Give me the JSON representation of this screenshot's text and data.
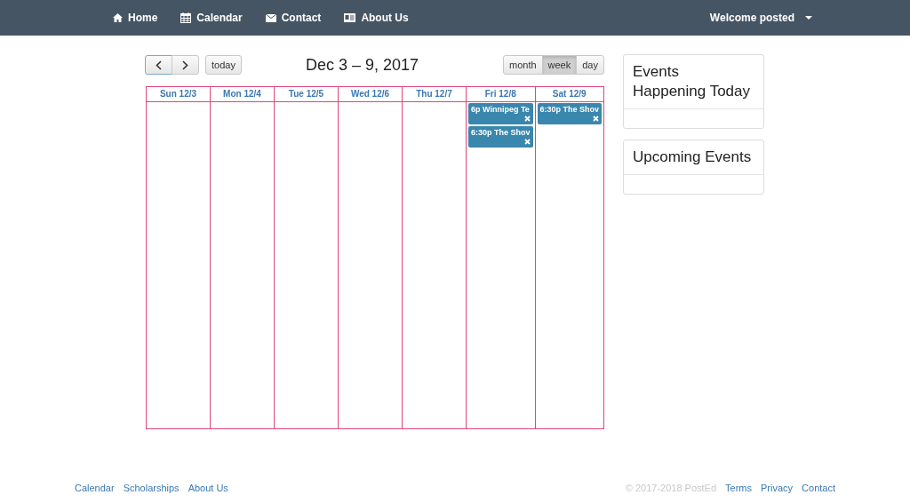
{
  "navbar": {
    "links": [
      {
        "label": "Home"
      },
      {
        "label": "Calendar"
      },
      {
        "label": "Contact"
      },
      {
        "label": "About Us"
      }
    ],
    "user_menu": "Welcome posted"
  },
  "toolbar": {
    "today": "today",
    "title": "Dec 3 – 9, 2017",
    "views": [
      {
        "label": "month",
        "selected": false
      },
      {
        "label": "week",
        "selected": true
      },
      {
        "label": "day",
        "selected": false
      }
    ]
  },
  "calendar": {
    "days": [
      {
        "label": "Sun 12/3"
      },
      {
        "label": "Mon 12/4"
      },
      {
        "label": "Tue 12/5"
      },
      {
        "label": "Wed 12/6"
      },
      {
        "label": "Thu 12/7"
      },
      {
        "label": "Fri 12/8",
        "events": [
          {
            "text": "6p Winnipeg Te"
          },
          {
            "text": "6:30p The Shov"
          }
        ]
      },
      {
        "label": "Sat 12/9",
        "events": [
          {
            "text": "6:30p The Shov"
          }
        ]
      }
    ]
  },
  "sidebar": {
    "panels": [
      {
        "title": "Events Happening Today"
      },
      {
        "title": "Upcoming Events"
      }
    ]
  },
  "footer": {
    "links_left": [
      "Calendar",
      "Scholarships",
      "About Us"
    ],
    "copyright": "© 2017-2018 PostEd",
    "links_right": [
      "Terms",
      "Privacy",
      "Contact"
    ]
  }
}
